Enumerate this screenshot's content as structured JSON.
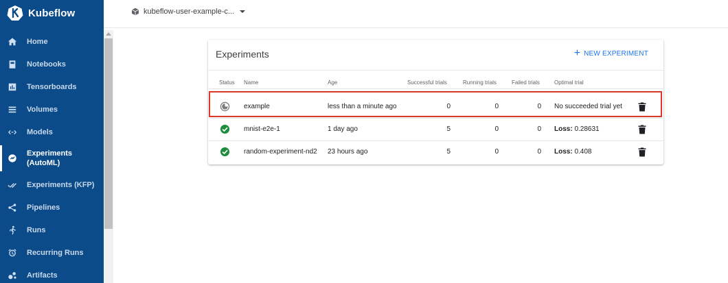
{
  "brand": {
    "name": "Kubeflow"
  },
  "namespace": {
    "label": "kubeflow-user-example-c..."
  },
  "sidebar": {
    "items": [
      {
        "label": "Home",
        "icon": "home-icon"
      },
      {
        "label": "Notebooks",
        "icon": "notebook-icon"
      },
      {
        "label": "Tensorboards",
        "icon": "tensorboard-icon"
      },
      {
        "label": "Volumes",
        "icon": "volumes-icon"
      },
      {
        "label": "Models",
        "icon": "models-icon"
      },
      {
        "label": "Experiments (AutoML)",
        "icon": "experiments-icon",
        "active": true
      },
      {
        "label": "Experiments (KFP)",
        "icon": "experiments-kfp-icon"
      },
      {
        "label": "Pipelines",
        "icon": "pipelines-icon"
      },
      {
        "label": "Runs",
        "icon": "runs-icon"
      },
      {
        "label": "Recurring Runs",
        "icon": "alarm-icon"
      },
      {
        "label": "Artifacts",
        "icon": "artifacts-icon"
      }
    ]
  },
  "card": {
    "title": "Experiments",
    "new_button": "NEW EXPERIMENT",
    "columns": {
      "status": "Status",
      "name": "Name",
      "age": "Age",
      "successful": "Successful trials",
      "running": "Running trials",
      "failed": "Failed trials",
      "optimal": "Optimal trial"
    },
    "rows": [
      {
        "status": "running",
        "name": "example",
        "age": "less than a minute ago",
        "successful": "0",
        "running": "0",
        "failed": "0",
        "optimal_label": "",
        "optimal_value": "No succeeded trial yet"
      },
      {
        "status": "succeeded",
        "name": "mnist-e2e-1",
        "age": "1 day ago",
        "successful": "5",
        "running": "0",
        "failed": "0",
        "optimal_label": "Loss:",
        "optimal_value": " 0.28631"
      },
      {
        "status": "succeeded",
        "name": "random-experiment-nd2",
        "age": "23 hours ago",
        "successful": "5",
        "running": "0",
        "failed": "0",
        "optimal_label": "Loss:",
        "optimal_value": " 0.408"
      }
    ]
  },
  "colors": {
    "sidebar": "#0b4b89",
    "accent": "#1a73e8",
    "success": "#1e8e3e",
    "highlight": "#e0352b"
  }
}
